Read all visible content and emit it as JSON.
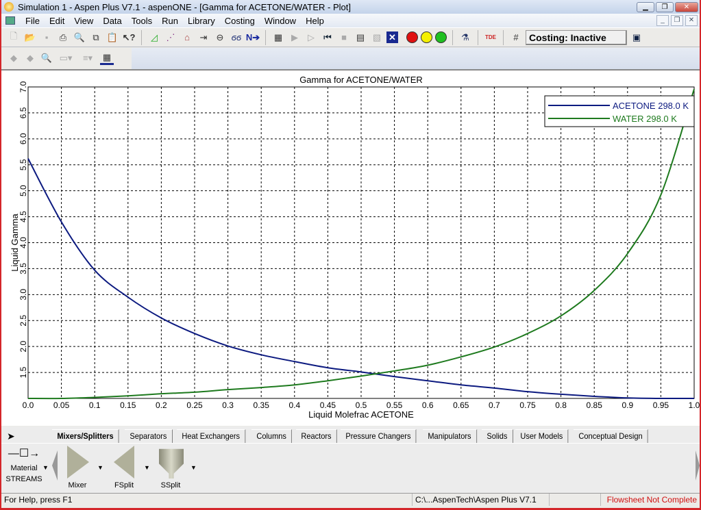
{
  "window": {
    "title": "Simulation 1 - Aspen Plus V7.1 - aspenONE - [Gamma for ACETONE/WATER - Plot]"
  },
  "menu": [
    "File",
    "Edit",
    "View",
    "Data",
    "Tools",
    "Run",
    "Library",
    "Costing",
    "Window",
    "Help"
  ],
  "toolbar": {
    "icons": [
      "new-icon",
      "open-icon",
      "save-icon",
      "print-icon",
      "print-preview-icon",
      "copy-icon",
      "paste-icon",
      "help-pointer-icon",
      "data-browser-icon",
      "flowsheet-icon",
      "model-library-icon",
      "stream-icon",
      "heater-icon",
      "glasses-icon",
      "next-icon",
      "control-panel-icon",
      "run-icon",
      "step-icon",
      "rewind-icon",
      "stop-icon",
      "results-icon",
      "reports-icon",
      "close-x-icon"
    ],
    "traffic_lights": {
      "red": "#e01010",
      "yellow": "#f5f000",
      "green": "#20c020"
    },
    "costing_label": "Costing: Inactive"
  },
  "toolbar2": {
    "icons": [
      "back-icon",
      "forward-icon",
      "zoom-icon",
      "layout-icon",
      "align-icon",
      "display-icon"
    ]
  },
  "chart_data": {
    "type": "line",
    "title": "Gamma for ACETONE/WATER",
    "xlabel": "Liquid Molefrac ACETONE",
    "ylabel": "Liquid Gamma",
    "xlim": [
      0,
      1
    ],
    "ylim": [
      1,
      7
    ],
    "xticks": [
      "0.0",
      "0.05",
      "0.1",
      "0.15",
      "0.2",
      "0.25",
      "0.3",
      "0.35",
      "0.4",
      "0.45",
      "0.5",
      "0.55",
      "0.6",
      "0.65",
      "0.7",
      "0.75",
      "0.8",
      "0.85",
      "0.9",
      "0.95",
      "1.0"
    ],
    "yticks": [
      "1.5",
      "2.0",
      "2.5",
      "3.0",
      "3.5",
      "4.0",
      "4.5",
      "5.0",
      "5.5",
      "6.0",
      "6.5",
      "7.0"
    ],
    "grid": true,
    "legend_placement": "top-right",
    "x": [
      0,
      0.05,
      0.1,
      0.15,
      0.2,
      0.25,
      0.3,
      0.35,
      0.4,
      0.45,
      0.5,
      0.55,
      0.6,
      0.65,
      0.7,
      0.75,
      0.8,
      0.85,
      0.9,
      0.95,
      1.0
    ],
    "series": [
      {
        "name": "ACETONE  298.0 K",
        "color": "#0c1a80",
        "values": [
          5.62,
          4.4,
          3.47,
          2.95,
          2.55,
          2.25,
          2.01,
          1.84,
          1.71,
          1.59,
          1.51,
          1.42,
          1.34,
          1.26,
          1.2,
          1.13,
          1.08,
          1.04,
          1.01,
          1.0,
          1.0
        ]
      },
      {
        "name": "WATER  298.0 K",
        "color": "#1e7a1e",
        "values": [
          1.0,
          1.0,
          1.02,
          1.05,
          1.09,
          1.12,
          1.17,
          1.21,
          1.26,
          1.34,
          1.43,
          1.53,
          1.64,
          1.8,
          1.99,
          2.25,
          2.59,
          3.08,
          3.79,
          4.92,
          6.96
        ]
      }
    ]
  },
  "palette": {
    "tabs": [
      "Mixers/Splitters",
      "Separators",
      "Heat Exchangers",
      "Columns",
      "Reactors",
      "Pressure Changers",
      "Manipulators",
      "Solids",
      "User Models",
      "Conceptual Design"
    ],
    "active_tab": "Mixers/Splitters",
    "streams": {
      "line1": "Material",
      "line2": "STREAMS"
    },
    "models": [
      "Mixer",
      "FSplit",
      "SSplit"
    ]
  },
  "status": {
    "help": "For Help, press F1",
    "path": "C:\\...AspenTech\\Aspen Plus V7.1",
    "state": "Flowsheet Not Complete",
    "state_color": "#d01010"
  }
}
